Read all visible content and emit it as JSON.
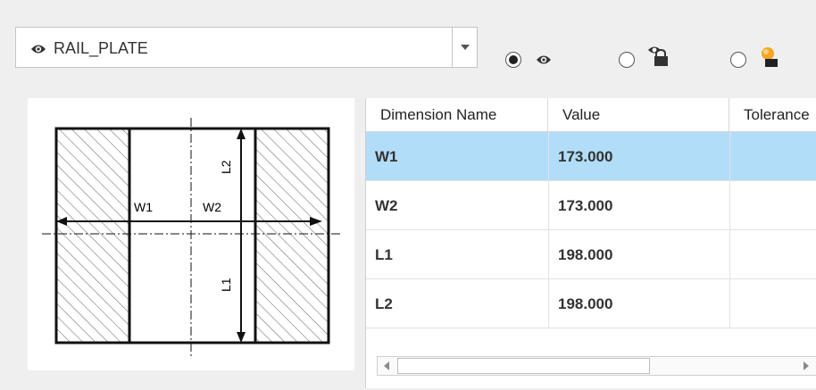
{
  "selector": {
    "value": "RAIL_PLATE"
  },
  "diagram": {
    "labels": {
      "w1": "W1",
      "w2": "W2",
      "l1": "L1",
      "l2": "L2"
    }
  },
  "table": {
    "headers": [
      "Dimension Name",
      "Value",
      "Tolerance"
    ],
    "rows": [
      {
        "name": "W1",
        "value": "173.000",
        "tolerance": ""
      },
      {
        "name": "W2",
        "value": "173.000",
        "tolerance": ""
      },
      {
        "name": "L1",
        "value": "198.000",
        "tolerance": ""
      },
      {
        "name": "L2",
        "value": "198.000",
        "tolerance": ""
      }
    ],
    "selected_row": 0
  },
  "radios": [
    {
      "icon": "eye-icon",
      "checked": true
    },
    {
      "icon": "lock-icon",
      "checked": false
    },
    {
      "icon": "shading-icon",
      "checked": false
    }
  ],
  "colors": {
    "selection": "#b2ddf8"
  }
}
